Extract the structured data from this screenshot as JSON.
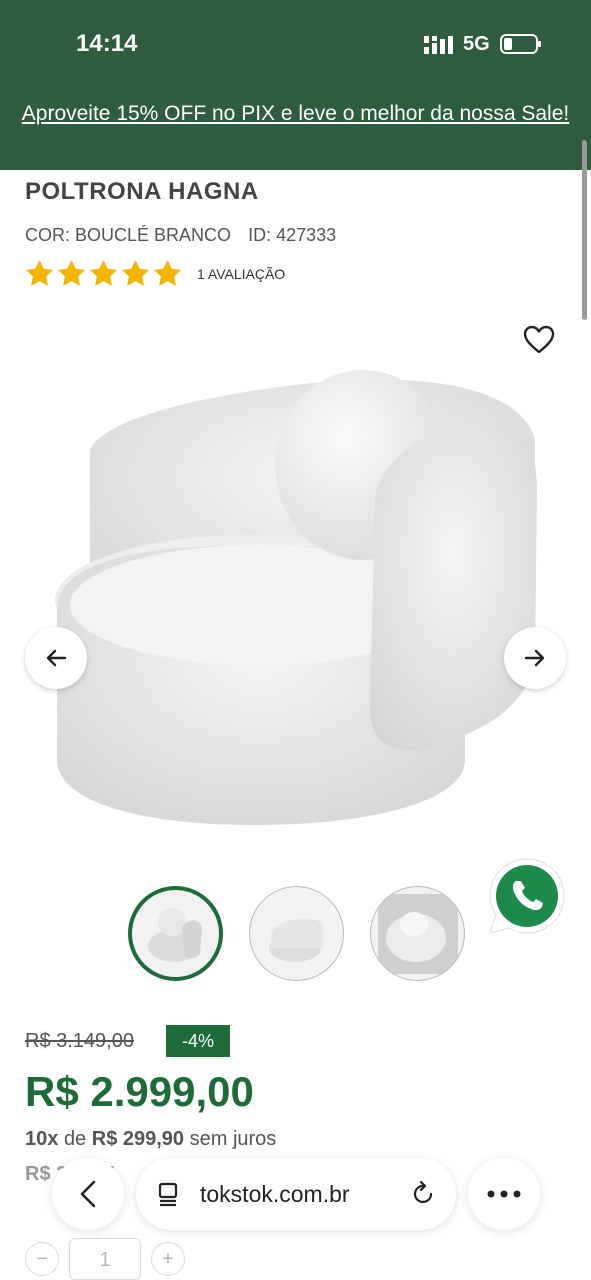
{
  "status": {
    "time": "14:14",
    "network": "5G"
  },
  "promo": {
    "text": "Aproveite 15% OFF no PIX e leve o melhor da nossa Sale!"
  },
  "product": {
    "title": "POLTRONA HAGNA",
    "color": "COR: BOUCLÉ BRANCO",
    "id": "ID: 427333",
    "rating": 5,
    "reviews": "1 AVALIAÇÃO"
  },
  "gallery": {
    "thumbnail_count": 3,
    "active_index": 0
  },
  "pricing": {
    "old_price": "R$ 3.149,00",
    "discount": "-4%",
    "price": "R$ 2.999,00",
    "installments_count": "10x",
    "installments_of": "de",
    "installments_value": "R$ 299,90",
    "installments_suffix": "sem juros",
    "pix_partial": "R$ 2.5...,1"
  },
  "quantity": {
    "value": "1",
    "minus": "−",
    "plus": "+"
  },
  "browser": {
    "url": "tokstok.com.br"
  },
  "colors": {
    "brand_green": "#1e6b3a",
    "banner_green": "#2e5c3c",
    "star": "#f5b400",
    "whatsapp": "#25d366"
  },
  "icons": [
    "signal-icon",
    "battery-icon",
    "heart-icon",
    "arrow-left-icon",
    "arrow-right-icon",
    "whatsapp-icon",
    "back-icon",
    "tabs-icon",
    "reload-icon",
    "more-icon"
  ]
}
